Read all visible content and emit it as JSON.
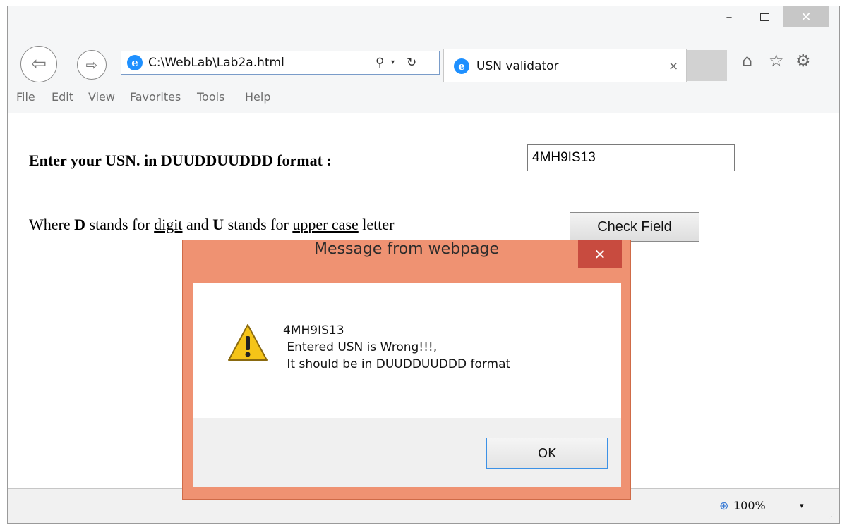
{
  "browser": {
    "address": "C:\\WebLab\\Lab2a.html",
    "tab_title": "USN validator",
    "tab_close": "×",
    "window_close": "✕",
    "minimize": "–",
    "search_icon": "⚲",
    "dropdown_icon": "▾",
    "refresh_icon": "↻",
    "back_icon": "⇦",
    "forward_icon": "⇨",
    "home_icon": "⌂",
    "favorites_icon": "☆",
    "settings_icon": "⚙",
    "menu": [
      "File",
      "Edit",
      "View",
      "Favorites",
      "Tools",
      "Help"
    ],
    "zoom": "100%",
    "zoom_icon": "⊕"
  },
  "page": {
    "prompt_label": "Enter your USN. in DUUDDUUDDD format :",
    "usn_value": "4MH9IS13",
    "hint": {
      "part1": "Where ",
      "D": "D",
      "part2": " stands for ",
      "digit": "digit",
      "part3": " and ",
      "U": "U",
      "part4": " stands for ",
      "upper_case": "upper case",
      "part5": " letter"
    },
    "check_button": "Check Field"
  },
  "dialog": {
    "title": "Message from webpage",
    "close": "✕",
    "message_lines": [
      "4MH9IS13",
      " Entered USN is Wrong!!!,",
      " It should be in DUUDDUUDDD format"
    ],
    "ok": "OK",
    "icon": "warning-icon"
  }
}
